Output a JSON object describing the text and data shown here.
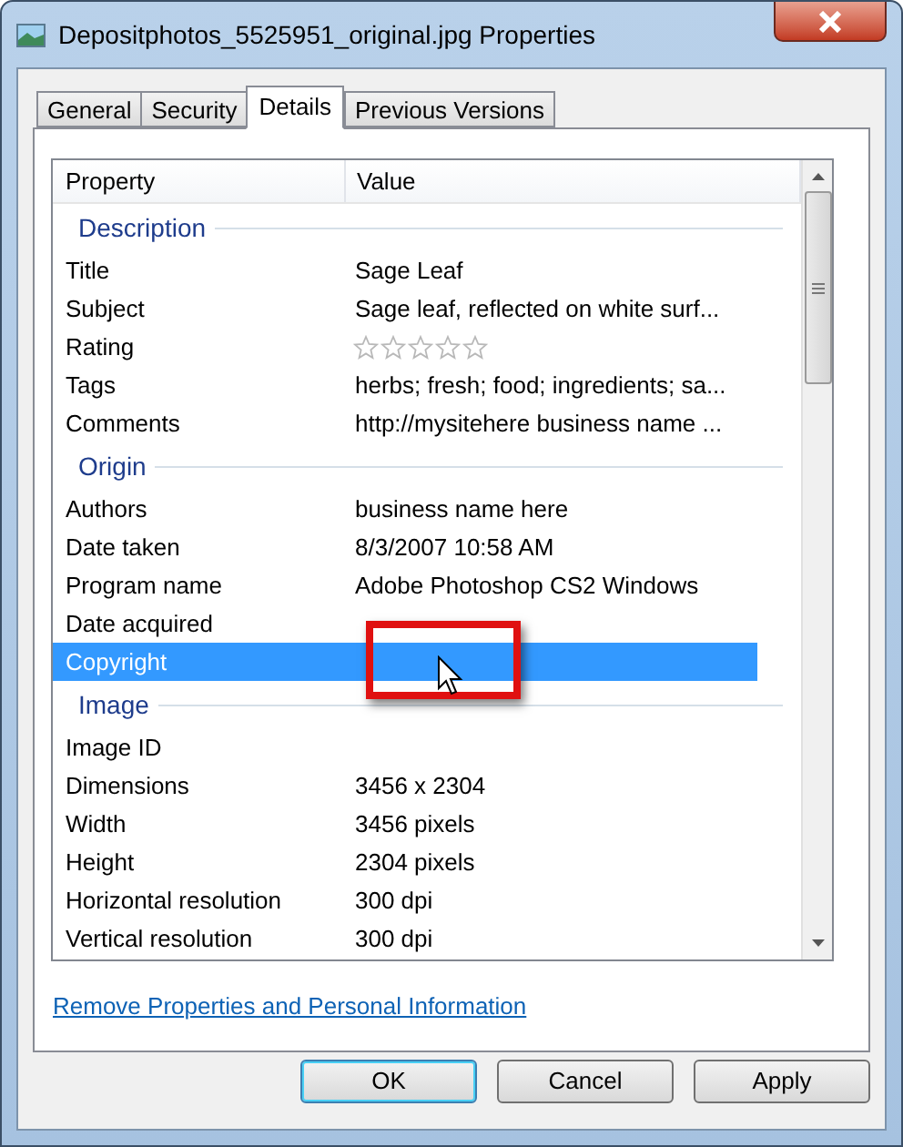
{
  "window": {
    "title": "Depositphotos_5525951_original.jpg Properties"
  },
  "tabs": [
    {
      "label": "General",
      "selected": false
    },
    {
      "label": "Security",
      "selected": false
    },
    {
      "label": "Details",
      "selected": true
    },
    {
      "label": "Previous Versions",
      "selected": false
    }
  ],
  "table": {
    "columns": [
      "Property",
      "Value"
    ],
    "rows": [
      {
        "kind": "group",
        "label": "Description"
      },
      {
        "kind": "property",
        "name": "Title",
        "value": "Sage Leaf",
        "selected": false
      },
      {
        "kind": "property",
        "name": "Subject",
        "value": "Sage leaf, reflected on white surf...",
        "selected": false
      },
      {
        "kind": "rating",
        "name": "Rating",
        "stars": 0,
        "selected": false
      },
      {
        "kind": "property",
        "name": "Tags",
        "value": "herbs; fresh; food; ingredients; sa...",
        "selected": false
      },
      {
        "kind": "property",
        "name": "Comments",
        "value": "http://mysitehere business name ...",
        "selected": false
      },
      {
        "kind": "group",
        "label": "Origin"
      },
      {
        "kind": "property",
        "name": "Authors",
        "value": "business name here",
        "selected": false
      },
      {
        "kind": "property",
        "name": "Date taken",
        "value": "8/3/2007 10:58 AM",
        "selected": false
      },
      {
        "kind": "property",
        "name": "Program name",
        "value": "Adobe Photoshop CS2 Windows",
        "selected": false
      },
      {
        "kind": "property",
        "name": "Date acquired",
        "selected": false
      },
      {
        "kind": "property",
        "name": "Copyright",
        "selected": true
      },
      {
        "kind": "group",
        "label": "Image"
      },
      {
        "kind": "property",
        "name": "Image ID",
        "selected": false
      },
      {
        "kind": "property",
        "name": "Dimensions",
        "value": "3456 x 2304",
        "selected": false
      },
      {
        "kind": "property",
        "name": "Width",
        "value": "3456 pixels",
        "selected": false
      },
      {
        "kind": "property",
        "name": "Height",
        "value": "2304 pixels",
        "selected": false
      },
      {
        "kind": "property",
        "name": "Horizontal resolution",
        "value": "300 dpi",
        "selected": false
      },
      {
        "kind": "property",
        "name": "Vertical resolution",
        "value": "300 dpi",
        "selected": false
      }
    ]
  },
  "link": "Remove Properties and Personal Information",
  "buttons": [
    {
      "label": "OK",
      "default": true
    },
    {
      "label": "Cancel",
      "default": false
    },
    {
      "label": "Apply",
      "default": false
    }
  ]
}
